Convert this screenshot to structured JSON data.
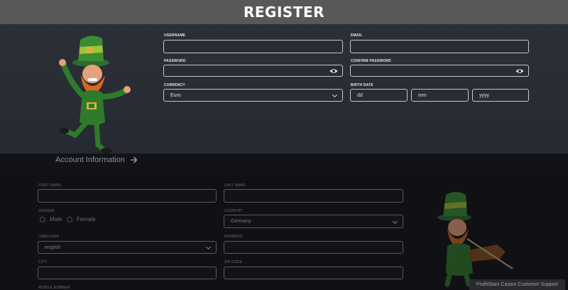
{
  "header": {
    "title": "REGISTER"
  },
  "account": {
    "username_label": "USERNAME",
    "username_value": "",
    "email_label": "EMAIL",
    "email_value": "",
    "password_label": "PASSWORD",
    "confirm_label": "CONFIRM PASSWORD",
    "currency_label": "CURRENCY",
    "currency_value": "Euro",
    "birth_label": "BIRTH DATE",
    "birth_day": "dd",
    "birth_month": "mm",
    "birth_year": "yyyy"
  },
  "section": {
    "title": "Account Information",
    "arrow_icon": "arrow-right-icon"
  },
  "personal": {
    "first_name_label": "FIRST NAME",
    "last_name_label": "LAST NAME",
    "gender_label": "GENDER",
    "gender_options": [
      "Male",
      "Female"
    ],
    "country_label": "COUNTRY",
    "country_value": "Germany",
    "language_label": "LANGUAGE",
    "language_value": "english",
    "address_label": "ADDRESS",
    "city_label": "CITY",
    "zip_label": "ZIP CODE",
    "mobile_label": "MOBILE NUMBER"
  },
  "support": {
    "label": "ProfitStarz Casino Customer Support"
  },
  "colors": {
    "header_bg": "#585858",
    "top_bg": "#2b2f37",
    "bottom_bg": "#101114",
    "leprechaun_green": "#2f7a2b",
    "beard_orange": "#d7661f"
  }
}
